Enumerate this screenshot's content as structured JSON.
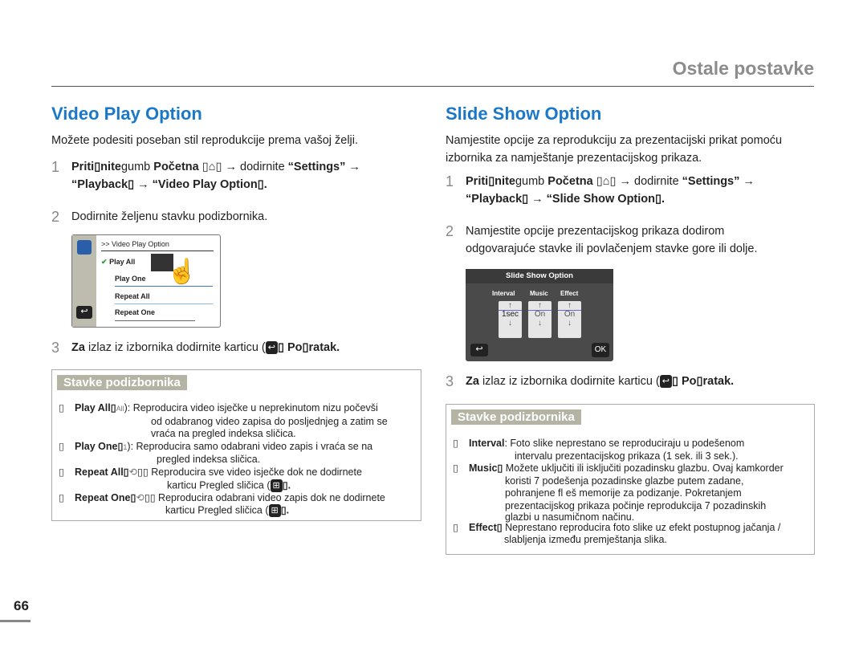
{
  "header": {
    "section": "Ostale postavke"
  },
  "left": {
    "title": "Video Play Option",
    "intro": "Možete podesiti poseban stil reprodukcije prema vašoj želji.",
    "step1": {
      "n": "1",
      "a": "Priti▯nite",
      "b": "gumb ",
      "c": "Početna",
      "d": " ▯",
      "e": "▯ → dodirnite ",
      "f": "“Settings”",
      "g": " →",
      "h": "“Playback▯",
      "i": " → “Video Play Option▯."
    },
    "step2": {
      "n": "2",
      "text": "Dodirnite željenu stavku podizbornika."
    },
    "screen": {
      "header": ">> Video Play Option",
      "items": [
        "Play All",
        "Play One",
        "Repeat All",
        "Repeat One"
      ]
    },
    "step3": {
      "n": "3",
      "a": "Za",
      "b": " izlaz iz izbornika dodirnite karticu (",
      "c": "▯ Po▯ratak."
    },
    "box": {
      "title": "Stavke podizbornika",
      "items": [
        {
          "label": "Play All▯",
          "icon": "All",
          "l1": "): Reproducira video isječke u neprekinutom nizu počevši",
          "l2": "od odabranog video zapisa do posljednjeg a zatim se",
          "l3": "vraća na pregled indeksa sličica."
        },
        {
          "label": "Play One▯",
          "icon": "1",
          "l1": "): Reproducira samo odabrani video zapis i vraća se na",
          "l2": "pregled indeksa sličica."
        },
        {
          "label": "Repeat All▯",
          "icon": "⟲",
          "l1": "▯▯ Reproducira sve video isječke dok ne dodirnete",
          "l2": "karticu Pregled sličica (",
          "l3": "▯."
        },
        {
          "label": "Repeat One▯",
          "icon": "⟲",
          "l1": "▯▯ Reproducira odabrani video zapis dok ne dodirnete",
          "l2": "karticu Pregled sličica (",
          "l3": "▯."
        }
      ]
    }
  },
  "right": {
    "title": "Slide Show Option",
    "intro1": "Namjestite opcije za reprodukciju za prezentacijski prikat pomoću",
    "intro2": "izbornika za namještanje prezentacijskog prikaza.",
    "step1": {
      "n": "1",
      "a": "Priti▯nite",
      "b": "gumb ",
      "c": "Početna",
      "d": " ▯",
      "e": "▯ → dodirnite ",
      "f": "“Settings”",
      "g": " →",
      "h": "“Playback▯",
      "i": " → “Slide Show Option▯."
    },
    "step2": {
      "n": "2",
      "l1": "Namjestite opcije prezentacijskog prikaza dodirom",
      "l2": "odgovarajuće stavke ili povlačenjem stavke gore ili dolje."
    },
    "screen": {
      "title": "Slide Show Option",
      "cols": [
        "Interval",
        "Music",
        "Effect"
      ],
      "vals": [
        "1sec",
        "On",
        "On"
      ],
      "ok": "OK"
    },
    "step3": {
      "n": "3",
      "a": "Za",
      "b": " izlaz iz izbornika dodirnite karticu (",
      "c": "▯ Po▯ratak."
    },
    "box": {
      "title": "Stavke podizbornika",
      "items": [
        {
          "label": "Interval",
          "l1": ": Foto slike neprestano se reproduciraju u podešenom",
          "l2": "intervalu prezentacijskog prikaza (1 sek. ili 3 sek.)."
        },
        {
          "label": "Music▯",
          "l1": " Možete uključiti ili isključiti pozadinsku glazbu. Ovaj kamkorder",
          "l2": "koristi 7 podešenja pozadinske glazbe putem zadane,",
          "l3": "pohranjene fl eš memorije za podizanje. Pokretanjem",
          "l4": "prezentacijskog prikaza počinje reprodukcija 7 pozadinskih",
          "l5": "glazbi u nasumičnom načinu."
        },
        {
          "label": "Effect▯",
          "l1": " Neprestano reproducira foto slike uz efekt postupnog jačanja /",
          "l2": "slabljenja između premještanja slika."
        }
      ]
    }
  },
  "footer": {
    "page": "66"
  },
  "colors": {
    "heading": "#1b78c9",
    "box_title_bg": "#b5b4a4"
  }
}
